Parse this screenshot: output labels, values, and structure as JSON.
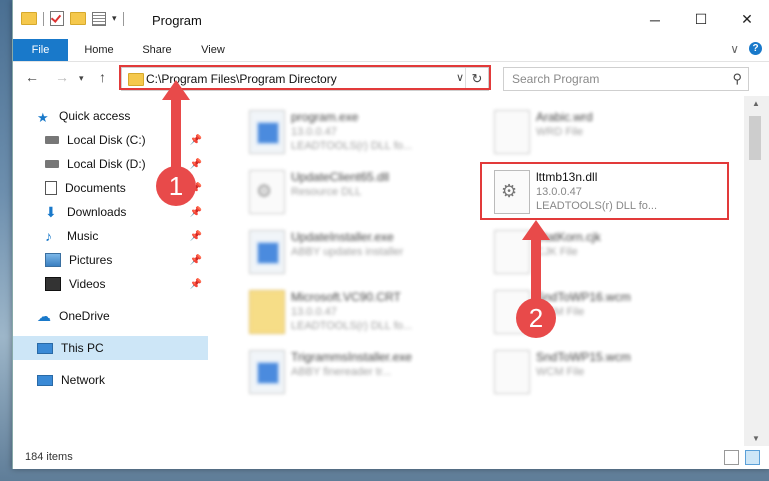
{
  "window": {
    "title": "Program",
    "minimize": "─",
    "maximize": "☐",
    "close": "✕"
  },
  "ribbon": {
    "tabs": [
      "File",
      "Home",
      "Share",
      "View"
    ],
    "chevron": "∨",
    "help": "?"
  },
  "navbar": {
    "back": "←",
    "forward": "→",
    "up": "↑",
    "path": "C:\\Program Files\\Program Directory",
    "dropdown": "∨",
    "refresh": "↻"
  },
  "search": {
    "placeholder": "Search Program",
    "icon": "search-icon"
  },
  "sidebar": {
    "items": [
      {
        "label": "Quick access",
        "icon": "star-icon",
        "pinned": false
      },
      {
        "label": "Local Disk (C:)",
        "icon": "drive-icon",
        "pinned": true
      },
      {
        "label": "Local Disk (D:)",
        "icon": "drive-icon",
        "pinned": true
      },
      {
        "label": "Documents",
        "icon": "documents-icon",
        "pinned": true
      },
      {
        "label": "Downloads",
        "icon": "download-icon",
        "pinned": true
      },
      {
        "label": "Music",
        "icon": "music-icon",
        "pinned": true
      },
      {
        "label": "Pictures",
        "icon": "pictures-icon",
        "pinned": true
      },
      {
        "label": "Videos",
        "icon": "videos-icon",
        "pinned": true
      },
      {
        "label": "OneDrive",
        "icon": "cloud-icon",
        "pinned": false
      },
      {
        "label": "This PC",
        "icon": "computer-icon",
        "pinned": false
      },
      {
        "label": "Network",
        "icon": "network-icon",
        "pinned": false
      }
    ]
  },
  "files": [
    {
      "name": "program.exe",
      "line2": "13.0.0.47",
      "line3": "LEADTOOLS(r) DLL fo...",
      "icon": "app"
    },
    {
      "name": "Arabic.wrd",
      "line2": "WRD File",
      "line3": "",
      "icon": "doc"
    },
    {
      "name": "UpdateClient65.dll",
      "line2": "Resource DLL",
      "line3": "",
      "icon": "gear"
    },
    {
      "name": "lttmb13n.dll",
      "line2": "13.0.0.47",
      "line3": "LEADTOOLS(r) DLL fo...",
      "icon": "gear"
    },
    {
      "name": "UpdateInstaller.exe",
      "line2": "ABBY updates installer",
      "line3": "",
      "icon": "app"
    },
    {
      "name": "StatKorn.cjk",
      "line2": "CJK File",
      "line3": "",
      "icon": "doc"
    },
    {
      "name": "Microsoft.VC90.CRT",
      "line2": "13.0.0.47",
      "line3": "LEADTOOLS(r) DLL fo...",
      "icon": "folder"
    },
    {
      "name": "SndToWP16.wcm",
      "line2": "WCM File",
      "line3": "",
      "icon": "doc"
    },
    {
      "name": "TrigrammsInstaller.exe",
      "line2": "ABBY finereader tr...",
      "line3": "",
      "icon": "app"
    },
    {
      "name": "SndToWP15.wcm",
      "line2": "WCM File",
      "line3": "",
      "icon": "doc"
    }
  ],
  "status": {
    "count": "184 items"
  },
  "annotations": {
    "step1": "1",
    "step2": "2",
    "color": "#e84a4a"
  }
}
